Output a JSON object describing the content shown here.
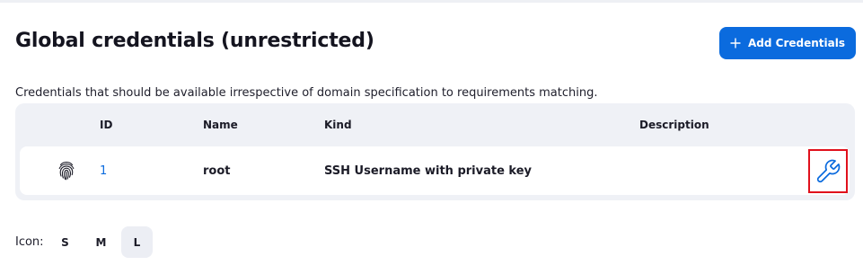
{
  "page": {
    "title": "Global credentials (unrestricted)",
    "description": "Credentials that should be available irrespective of domain specification to requirements matching."
  },
  "toolbar": {
    "add_label": "Add Credentials",
    "add_icon": "plus-icon"
  },
  "table": {
    "columns": [
      "ID",
      "Name",
      "Kind",
      "Description"
    ],
    "rows": [
      {
        "icon": "fingerprint-icon",
        "id": "1",
        "name": "root",
        "kind": "SSH Username with private key",
        "description": "",
        "action_icon": "wrench-icon"
      }
    ]
  },
  "icon_size": {
    "label": "Icon:",
    "options": [
      "S",
      "M",
      "L"
    ],
    "selected": "L"
  },
  "colors": {
    "accent": "#0b6bde",
    "highlight": "#e0101c",
    "table_bg": "#eff1f6"
  }
}
